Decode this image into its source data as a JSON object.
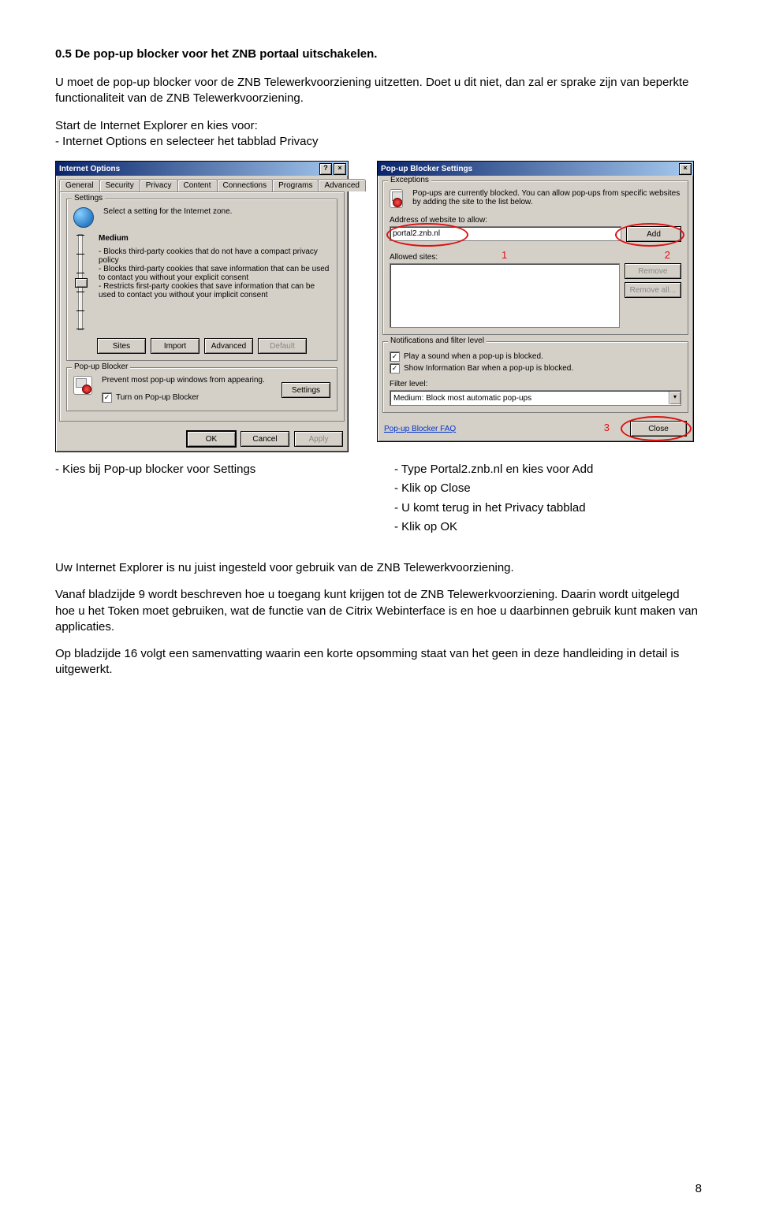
{
  "section_title": "0.5 De pop-up blocker voor het ZNB portaal uitschakelen.",
  "intro_p1": "U moet de pop-up blocker voor de ZNB Telewerkvoorziening uitzetten. Doet u dit niet, dan zal er sprake zijn van beperkte functionaliteit van de ZNB Telewerkvoorziening.",
  "intro_p2a": "Start de Internet Explorer en kies voor:",
  "intro_p2b": "- Internet Options en selecteer het tabblad Privacy",
  "mid_left_1": "- Kies bij Pop-up blocker voor Settings",
  "mid_right_1": "- Type Portal2.znb.nl en kies voor Add",
  "mid_right_2": "- Klik op Close",
  "mid_right_3": "- U komt terug in het Privacy tabblad",
  "mid_right_4": "- Klik op OK",
  "outro_p1": "Uw Internet Explorer is nu juist ingesteld voor gebruik van de ZNB Telewerkvoorziening.",
  "outro_p2": "Vanaf bladzijde 9 wordt beschreven hoe u toegang kunt krijgen tot de ZNB Telewerkvoorziening. Daarin wordt uitgelegd hoe u het Token moet gebruiken, wat de functie van de Citrix Webinterface is en hoe u daarbinnen gebruik kunt maken van applicaties.",
  "outro_p3": "Op bladzijde 16 volgt een samenvatting waarin een korte opsomming staat van het geen in deze handleiding in detail is uitgewerkt.",
  "page_number": "8",
  "dialog_io": {
    "title": "Internet Options",
    "title_help_icon": "?",
    "tabs": [
      "General",
      "Security",
      "Privacy",
      "Content",
      "Connections",
      "Programs",
      "Advanced"
    ],
    "active_tab_index": 2,
    "settings_group": "Settings",
    "settings_caption": "Select a setting for the Internet zone.",
    "slider_level": "Medium",
    "privacy_line1": "- Blocks third-party cookies that do not have a compact privacy policy",
    "privacy_line2": "- Blocks third-party cookies that save information that can be used to contact you without your explicit consent",
    "privacy_line3": "- Restricts first-party cookies that save information that can be used to contact you without your implicit consent",
    "btn_sites": "Sites",
    "btn_import": "Import",
    "btn_advanced": "Advanced",
    "btn_default": "Default",
    "popup_group": "Pop-up Blocker",
    "popup_caption": "Prevent most pop-up windows from appearing.",
    "chk_turn_on": "Turn on Pop-up Blocker",
    "chk_turn_on_checked": "✓",
    "btn_settings": "Settings",
    "btn_ok": "OK",
    "btn_cancel": "Cancel",
    "btn_apply": "Apply"
  },
  "dialog_pb": {
    "title": "Pop-up Blocker Settings",
    "exceptions_group": "Exceptions",
    "exceptions_caption": "Pop-ups are currently blocked. You can allow pop-ups from specific websites by adding the site to the list below.",
    "address_label": "Address of website to allow:",
    "address_value": "portal2.znb.nl",
    "btn_add": "Add",
    "allowed_label": "Allowed sites:",
    "btn_remove": "Remove",
    "btn_removeall": "Remove all...",
    "notif_group": "Notifications and filter level",
    "chk_sound": "Play a sound when a pop-up is blocked.",
    "chk_sound_checked": "✓",
    "chk_infobar": "Show Information Bar when a pop-up is blocked.",
    "chk_infobar_checked": "✓",
    "filter_label": "Filter level:",
    "filter_value": "Medium: Block most automatic pop-ups",
    "faq_link": "Pop-up Blocker FAQ",
    "btn_close": "Close",
    "annot1": "1",
    "annot2": "2",
    "annot3": "3"
  }
}
